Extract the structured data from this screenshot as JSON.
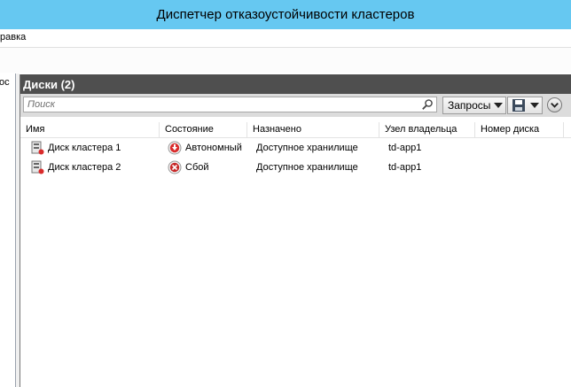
{
  "window": {
    "title": "Диспетчер отказоустойчивости кластеров"
  },
  "menu": {
    "help_label": "равка"
  },
  "left_pane": {
    "label": "ос"
  },
  "panel": {
    "title": "Диски (2)",
    "search": {
      "placeholder": "Поиск"
    },
    "queries_label": "Запросы",
    "columns": [
      "Имя",
      "Состояние",
      "Назначено",
      "Узел владельца",
      "Номер диска"
    ],
    "rows": [
      {
        "name": "Диск кластера 1",
        "status": "Автономный",
        "status_icon": "offline-arrow-icon",
        "assigned": "Доступное хранилище",
        "owner": "td-app1",
        "disk_number": ""
      },
      {
        "name": "Диск кластера 2",
        "status": "Сбой",
        "status_icon": "failed-x-icon",
        "assigned": "Доступное хранилище",
        "owner": "td-app1",
        "disk_number": ""
      }
    ]
  },
  "colors": {
    "titlebar": "#66c8f1",
    "panel_header": "#4f4f4f",
    "offline_red": "#d92b2b",
    "failed_red": "#c62828"
  }
}
